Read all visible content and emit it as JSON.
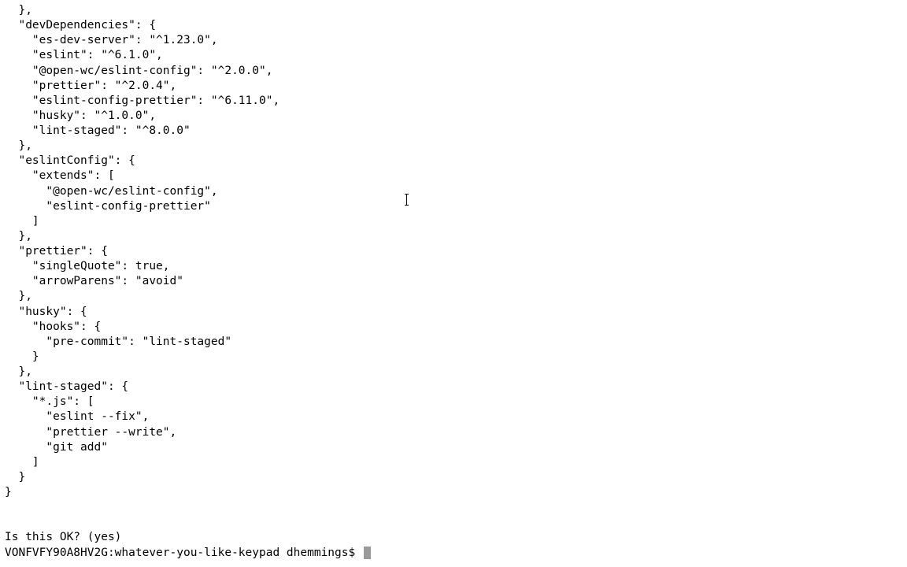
{
  "lines": [
    "  },",
    "  \"devDependencies\": {",
    "    \"es-dev-server\": \"^1.23.0\",",
    "    \"eslint\": \"^6.1.0\",",
    "    \"@open-wc/eslint-config\": \"^2.0.0\",",
    "    \"prettier\": \"^2.0.4\",",
    "    \"eslint-config-prettier\": \"^6.11.0\",",
    "    \"husky\": \"^1.0.0\",",
    "    \"lint-staged\": \"^8.0.0\"",
    "  },",
    "  \"eslintConfig\": {",
    "    \"extends\": [",
    "      \"@open-wc/eslint-config\",",
    "      \"eslint-config-prettier\"",
    "    ]",
    "  },",
    "  \"prettier\": {",
    "    \"singleQuote\": true,",
    "    \"arrowParens\": \"avoid\"",
    "  },",
    "  \"husky\": {",
    "    \"hooks\": {",
    "      \"pre-commit\": \"lint-staged\"",
    "    }",
    "  },",
    "  \"lint-staged\": {",
    "    \"*.js\": [",
    "      \"eslint --fix\",",
    "      \"prettier --write\",",
    "      \"git add\"",
    "    ]",
    "  }",
    "}",
    "",
    "",
    "Is this OK? (yes) "
  ],
  "prompt": "VONFVFY90A8HV2G:whatever-you-like-keypad dhemmings$ "
}
